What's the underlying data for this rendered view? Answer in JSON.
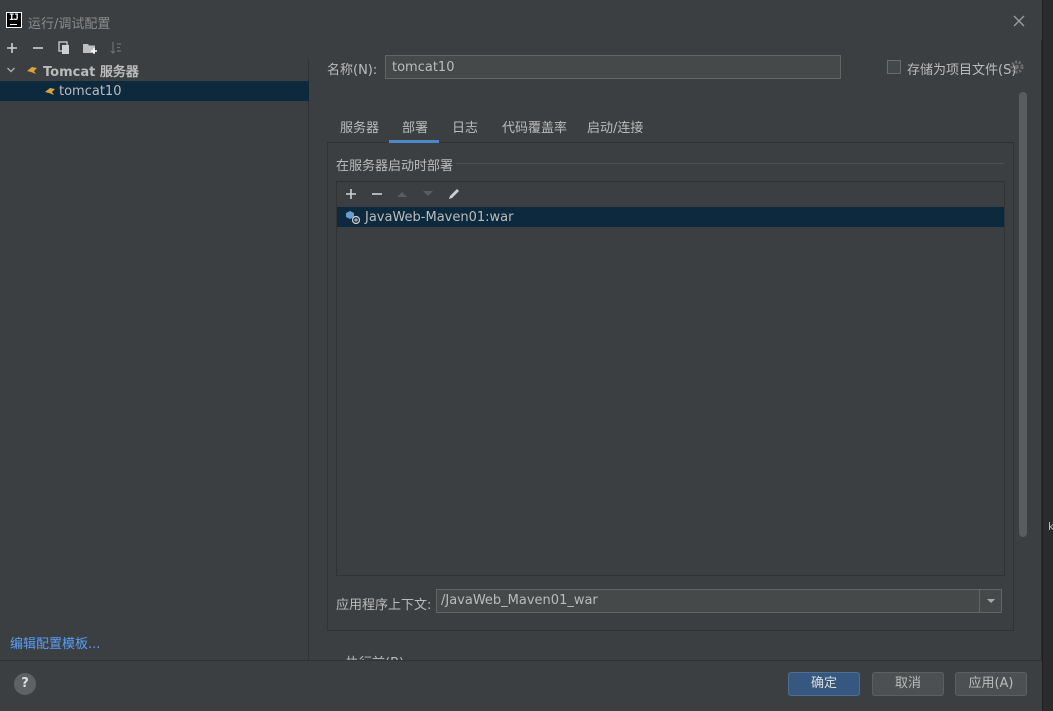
{
  "dialog": {
    "title": "运行/调试配置"
  },
  "left_toolbar": {
    "icons": [
      "add-icon",
      "remove-icon",
      "copy-icon",
      "new-folder-icon",
      "sort-icon"
    ]
  },
  "tree": {
    "group_label": "Tomcat 服务器",
    "item_label": "tomcat10"
  },
  "edit_templates_link": "编辑配置模板...",
  "form": {
    "name_label": "名称(N):",
    "name_value": "tomcat10",
    "store_as_project_label": "存储为项目文件(S)",
    "store_as_project_checked": false
  },
  "tabs": [
    {
      "label": "服务器",
      "active": false
    },
    {
      "label": "部署",
      "active": true
    },
    {
      "label": "日志",
      "active": false
    },
    {
      "label": "代码覆盖率",
      "active": false
    },
    {
      "label": "启动/连接",
      "active": false
    }
  ],
  "deploy": {
    "heading": "在服务器启动时部署",
    "toolbar_icons": [
      "add-icon",
      "remove-icon",
      "move-up-icon",
      "move-down-icon",
      "edit-icon"
    ],
    "artifact": "JavaWeb-Maven01:war",
    "context_label": "应用程序上下文:",
    "context_value": "/JavaWeb_Maven01_war"
  },
  "before_launch_label": "执行前(B)",
  "buttons": {
    "ok": "确定",
    "cancel": "取消",
    "apply": "应用(A)",
    "help": "?"
  },
  "colors": {
    "background": "#3c3f41",
    "selection": "#0d293e",
    "accent": "#4a88c7",
    "link": "#589df6",
    "primary_button": "#365880"
  }
}
